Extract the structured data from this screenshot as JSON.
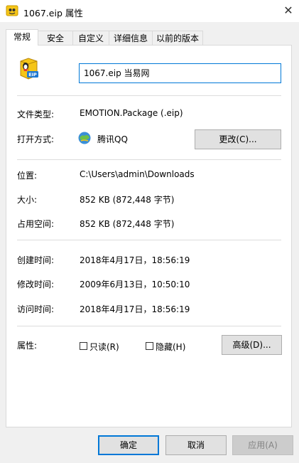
{
  "window": {
    "title": "1067.eip 属性",
    "close_symbol": "✕"
  },
  "tabs": [
    {
      "label": "常规"
    },
    {
      "label": "安全"
    },
    {
      "label": "自定义"
    },
    {
      "label": "详细信息"
    },
    {
      "label": "以前的版本"
    }
  ],
  "file": {
    "name": "1067.eip 当易网",
    "icon_badge": "EIP"
  },
  "props": {
    "type_label": "文件类型:",
    "type_value": "EMOTION.Package (.eip)",
    "open_label": "打开方式:",
    "open_value": "腾讯QQ",
    "change_button": "更改(C)...",
    "location_label": "位置:",
    "location_value": "C:\\Users\\admin\\Downloads",
    "size_label": "大小:",
    "size_value": "852 KB (872,448 字节)",
    "disk_label": "占用空间:",
    "disk_value": "852 KB (872,448 字节)",
    "created_label": "创建时间:",
    "created_value": "2018年4月17日，18:56:19",
    "modified_label": "修改时间:",
    "modified_value": "2009年6月13日，10:50:10",
    "accessed_label": "访问时间:",
    "accessed_value": "2018年4月17日，18:56:19",
    "attr_label": "属性:",
    "readonly_label": "只读(R)",
    "hidden_label": "隐藏(H)",
    "advanced_button": "高级(D)..."
  },
  "footer": {
    "ok": "确定",
    "cancel": "取消",
    "apply": "应用(A)"
  },
  "colors": {
    "accent": "#0078d7",
    "icon_yellow": "#f5c518",
    "icon_blue": "#1e78d2"
  }
}
